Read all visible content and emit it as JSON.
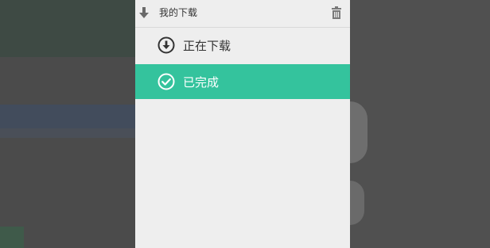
{
  "panel": {
    "title": "我的下载",
    "items": [
      {
        "label": "正在下载",
        "icon": "download-circle-icon",
        "selected": false
      },
      {
        "label": "已完成",
        "icon": "check-circle-icon",
        "selected": true
      }
    ]
  },
  "colors": {
    "accent": "#34c39d",
    "panel_bg": "#eeeeee",
    "overlay": "#4b4b4b"
  }
}
